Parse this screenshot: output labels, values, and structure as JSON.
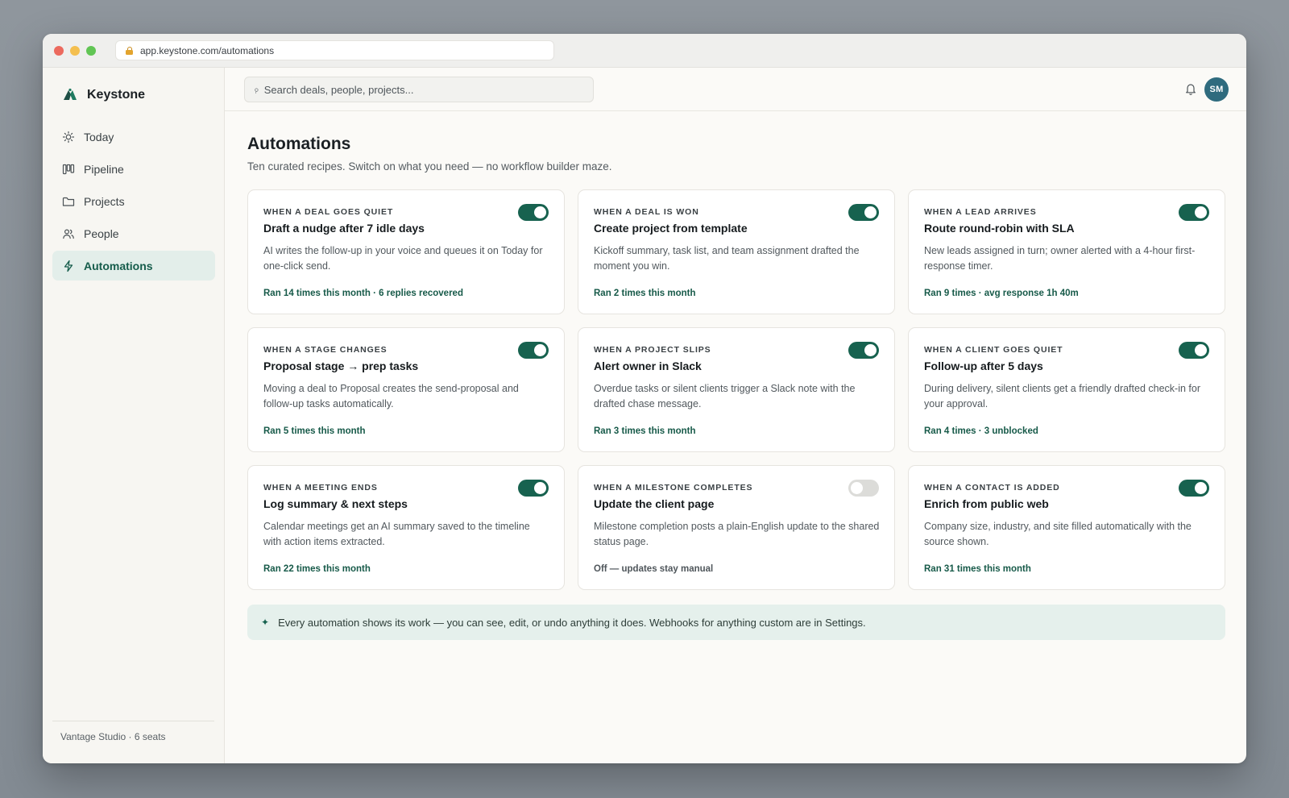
{
  "browser": {
    "url": "app.keystone.com/automations"
  },
  "brand": {
    "name": "Keystone"
  },
  "sidebar": {
    "items": [
      {
        "label": "Today",
        "icon": "sun-icon",
        "active": false
      },
      {
        "label": "Pipeline",
        "icon": "kanban-icon",
        "active": false
      },
      {
        "label": "Projects",
        "icon": "folder-icon",
        "active": false
      },
      {
        "label": "People",
        "icon": "people-icon",
        "active": false
      },
      {
        "label": "Automations",
        "icon": "bolt-icon",
        "active": true
      }
    ],
    "footer": "Vantage Studio · 6 seats"
  },
  "topbar": {
    "search_placeholder": "Search deals, people, projects...",
    "avatar_initials": "SM"
  },
  "page": {
    "title": "Automations",
    "subtitle": "Ten curated recipes. Switch on what you need — no workflow builder maze."
  },
  "automations": [
    {
      "trigger": "WHEN A DEAL GOES QUIET",
      "title": "Draft a nudge after 7 idle days",
      "description": "AI writes the follow-up in your voice and queues it on Today for one-click send.",
      "stat": "Ran 14 times this month · 6 replies recovered",
      "enabled": true
    },
    {
      "trigger": "WHEN A DEAL IS WON",
      "title": "Create project from template",
      "description": "Kickoff summary, task list, and team assignment drafted the moment you win.",
      "stat": "Ran 2 times this month",
      "enabled": true
    },
    {
      "trigger": "WHEN A LEAD ARRIVES",
      "title": "Route round-robin with SLA",
      "description": "New leads assigned in turn; owner alerted with a 4-hour first-response timer.",
      "stat": "Ran 9 times · avg response 1h 40m",
      "enabled": true
    },
    {
      "trigger": "WHEN A STAGE CHANGES",
      "title": "Proposal stage → prep tasks",
      "description": "Moving a deal to Proposal creates the send-proposal and follow-up tasks automatically.",
      "stat": "Ran 5 times this month",
      "enabled": true
    },
    {
      "trigger": "WHEN A PROJECT SLIPS",
      "title": "Alert owner in Slack",
      "description": "Overdue tasks or silent clients trigger a Slack note with the drafted chase message.",
      "stat": "Ran 3 times this month",
      "enabled": true
    },
    {
      "trigger": "WHEN A CLIENT GOES QUIET",
      "title": "Follow-up after 5 days",
      "description": "During delivery, silent clients get a friendly drafted check-in for your approval.",
      "stat": "Ran 4 times · 3 unblocked",
      "enabled": true
    },
    {
      "trigger": "WHEN A MEETING ENDS",
      "title": "Log summary & next steps",
      "description": "Calendar meetings get an AI summary saved to the timeline with action items extracted.",
      "stat": "Ran 22 times this month",
      "enabled": true
    },
    {
      "trigger": "WHEN A MILESTONE COMPLETES",
      "title": "Update the client page",
      "description": "Milestone completion posts a plain-English update to the shared status page.",
      "stat": "Off — updates stay manual",
      "enabled": false
    },
    {
      "trigger": "WHEN A CONTACT IS ADDED",
      "title": "Enrich from public web",
      "description": "Company size, industry, and site filled automatically with the source shown.",
      "stat": "Ran 31 times this month",
      "enabled": true
    }
  ],
  "banner": {
    "icon": "sparkle-icon",
    "text": "Every automation shows its work — you can see, edit, or undo anything it does. Webhooks for anything custom are in Settings."
  },
  "colors": {
    "accent": "#17624f",
    "accent_soft": "#e3eeea",
    "avatar": "#2f6b7e"
  }
}
